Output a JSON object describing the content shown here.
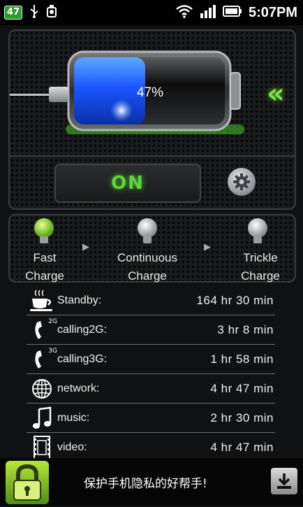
{
  "status_bar": {
    "battery_badge": "47",
    "time": "5:07PM"
  },
  "battery": {
    "percent_text": "47%",
    "level": 0.47,
    "charging_indicator": "«"
  },
  "controls": {
    "power_label": "ON",
    "settings_icon": "gear-icon"
  },
  "stages": [
    {
      "line1": "Fast",
      "line2": "Charge",
      "active": true
    },
    {
      "line1": "Continuous",
      "line2": "Charge",
      "active": false
    },
    {
      "line1": "Trickle",
      "line2": "Charge",
      "active": false
    }
  ],
  "usage": [
    {
      "label": "Standby:",
      "value": "164 hr  30 min",
      "icon": "coffee-cup-icon"
    },
    {
      "label": "calling2G:",
      "value": "3 hr  8 min",
      "icon": "phone-2g-icon",
      "badge": "2G"
    },
    {
      "label": "calling3G:",
      "value": "1 hr  58 min",
      "icon": "phone-3g-icon",
      "badge": "3G"
    },
    {
      "label": "network:",
      "value": "4 hr  47 min",
      "icon": "globe-icon"
    },
    {
      "label": "music:",
      "value": "2 hr  30 min",
      "icon": "music-note-icon"
    },
    {
      "label": "video:",
      "value": "4 hr  47 min",
      "icon": "film-icon"
    }
  ],
  "ad": {
    "text": "保护手机隐私的好帮手!"
  },
  "colors": {
    "accent_green": "#62d43a",
    "battery_blue": "#1f6bff"
  }
}
